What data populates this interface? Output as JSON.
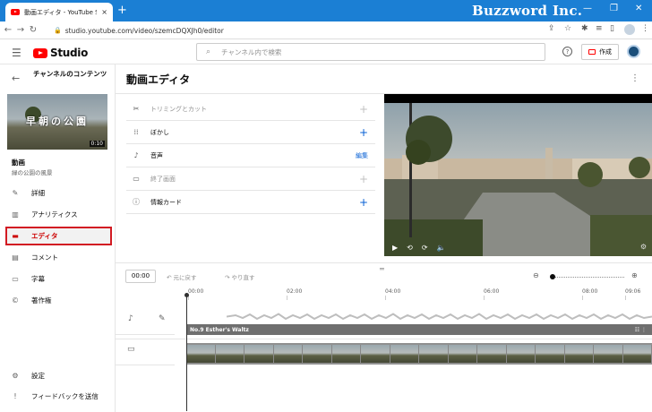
{
  "browser": {
    "tab_title": "動画エディタ - YouTube Studio",
    "close_tab": "×",
    "new_tab": "+",
    "url": "studio.youtube.com/video/szemcDQXJh0/editor",
    "watermark": "Buzzword Inc."
  },
  "header": {
    "logo_text": "Studio",
    "search_placeholder": "チャンネル内で検索",
    "help": "?",
    "create_label": "作成"
  },
  "sidebar": {
    "channel_title": "チャンネルのコンテンツ",
    "thumbnail_title": "早朝の公園",
    "thumbnail_duration": "0:10",
    "video_label": "動画",
    "video_name": "緑の公園の風景",
    "items": [
      {
        "label": "詳細",
        "icon": "pencil-icon"
      },
      {
        "label": "アナリティクス",
        "icon": "analytics-icon"
      },
      {
        "label": "エディタ",
        "icon": "editor-icon",
        "active": true
      },
      {
        "label": "コメント",
        "icon": "comment-icon"
      },
      {
        "label": "字幕",
        "icon": "subtitles-icon"
      },
      {
        "label": "著作権",
        "icon": "copyright-icon"
      }
    ],
    "bottom": [
      {
        "label": "設定",
        "icon": "gear-icon"
      },
      {
        "label": "フィードバックを送信",
        "icon": "feedback-icon"
      }
    ]
  },
  "main": {
    "title": "動画エディタ",
    "tools": [
      {
        "label": "トリミングとカット",
        "icon": "scissors-icon",
        "disabled": true
      },
      {
        "label": "ぼかし",
        "icon": "blur-icon",
        "disabled": false
      },
      {
        "label": "音声",
        "icon": "music-note-icon",
        "action": "編集"
      },
      {
        "label": "終了画面",
        "icon": "end-screen-icon",
        "disabled": true
      },
      {
        "label": "情報カード",
        "icon": "info-icon",
        "disabled": false
      }
    ]
  },
  "timeline": {
    "time": "00:00",
    "undo": "元に戻す",
    "redo": "やり直す",
    "ticks": [
      "00:00",
      "02:00",
      "04:00",
      "06:00",
      "08:00",
      "09:06"
    ],
    "music_title": "No.9 Esther's Waltz"
  },
  "colors": {
    "accent_red": "#d21a22",
    "link_blue": "#065fd4",
    "chrome_blue": "#1b7fd4"
  }
}
